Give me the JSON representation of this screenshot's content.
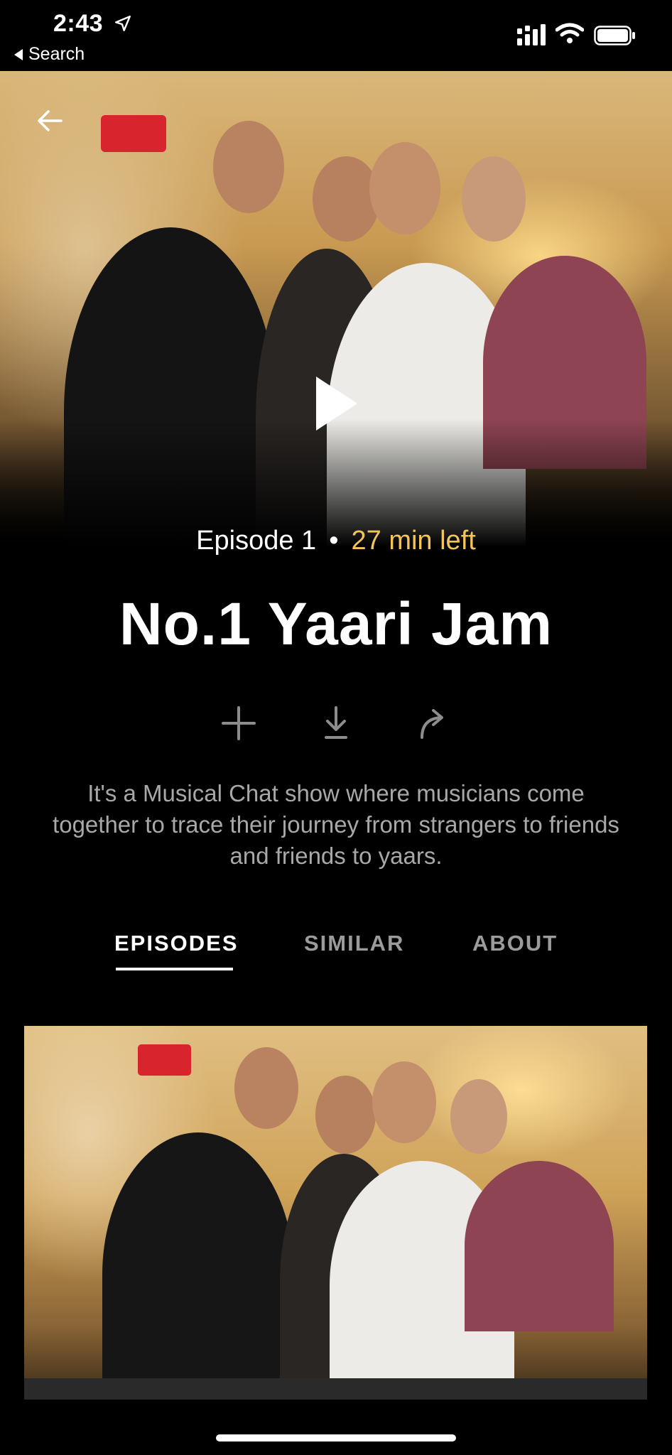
{
  "status_bar": {
    "time": "2:43",
    "back_label": "Search",
    "icons": [
      "location-arrow-icon",
      "cellular-signal-icon",
      "wifi-icon",
      "battery-icon"
    ]
  },
  "hero": {
    "icons": [
      "back-arrow-icon",
      "play-icon"
    ]
  },
  "episode": {
    "label": "Episode 1",
    "separator": "•",
    "time_left": "27 min left",
    "time_left_color": "#f2c55c"
  },
  "show": {
    "title": "No.1 Yaari Jam",
    "description": "It's a Musical Chat show where musicians come together to trace their journey from strangers to friends and friends to yaars."
  },
  "actions": [
    "add-icon",
    "download-icon",
    "share-icon"
  ],
  "tabs": [
    {
      "label": "EPISODES",
      "active": true
    },
    {
      "label": "SIMILAR",
      "active": false
    },
    {
      "label": "ABOUT",
      "active": false
    }
  ]
}
